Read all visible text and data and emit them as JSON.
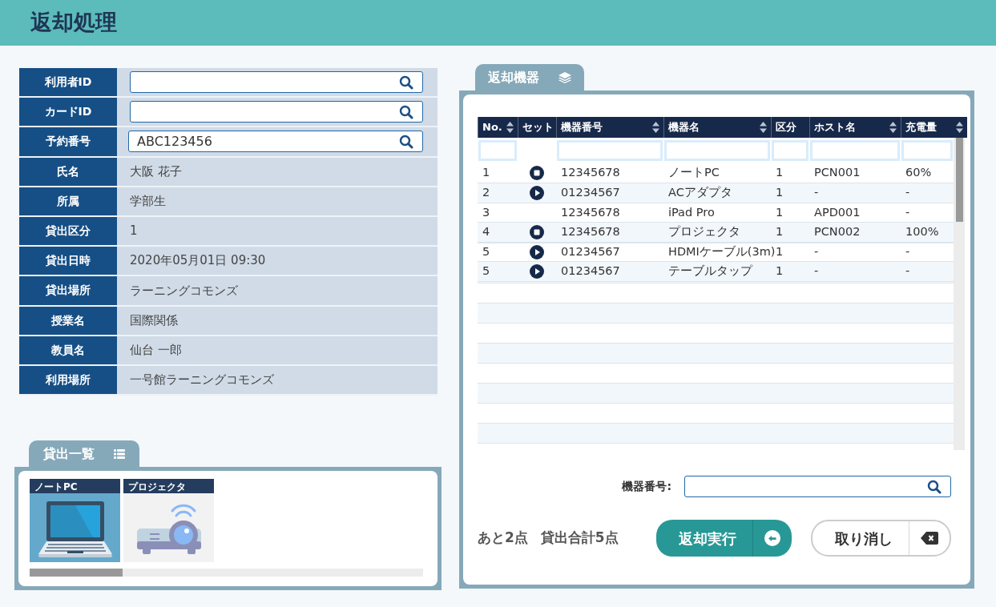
{
  "header": {
    "title": "返却処理"
  },
  "user_form": {
    "fields": [
      {
        "label": "利用者ID",
        "kind": "search"
      },
      {
        "label": "カードID",
        "kind": "search"
      },
      {
        "label": "予約番号",
        "kind": "search",
        "value": "ABC123456"
      },
      {
        "label": "氏名",
        "kind": "text",
        "value": "大阪 花子"
      },
      {
        "label": "所属",
        "kind": "text",
        "value": "学部生"
      },
      {
        "label": "貸出区分",
        "kind": "text",
        "value": "1"
      },
      {
        "label": "貸出日時",
        "kind": "text",
        "value": "2020年05月01日 09:30"
      },
      {
        "label": "貸出場所",
        "kind": "text",
        "value": "ラーニングコモンズ"
      },
      {
        "label": "授業名",
        "kind": "text",
        "value": "国際関係"
      },
      {
        "label": "教員名",
        "kind": "text",
        "value": "仙台 一郎"
      },
      {
        "label": "利用場所",
        "kind": "text",
        "value": "一号館ラーニングコモンズ"
      }
    ]
  },
  "loan_list": {
    "title": "貸出一覧",
    "items": [
      {
        "label": "ノートPC",
        "kind": "laptop",
        "selected": true
      },
      {
        "label": "プロジェクタ",
        "kind": "projector",
        "selected": false
      }
    ]
  },
  "return_devices": {
    "title": "返却機器",
    "columns": [
      {
        "label": "No.",
        "sortable": true,
        "filterable": true
      },
      {
        "label": "セット",
        "sortable": false,
        "filterable": false
      },
      {
        "label": "機器番号",
        "sortable": true,
        "filterable": true
      },
      {
        "label": "機器名",
        "sortable": true,
        "filterable": true
      },
      {
        "label": "区分",
        "sortable": false,
        "filterable": true
      },
      {
        "label": "ホスト名",
        "sortable": true,
        "filterable": true
      },
      {
        "label": "充電量",
        "sortable": true,
        "filterable": true
      }
    ],
    "rows": [
      {
        "no": "1",
        "kind": "stop",
        "device_no": "12345678",
        "device_name": "ノートPC",
        "category": "1",
        "host": "PCN001",
        "charge": "60%"
      },
      {
        "no": "2",
        "kind": "play",
        "device_no": "01234567",
        "device_name": "ACアダプタ",
        "category": "1",
        "host": "-",
        "charge": "-"
      },
      {
        "no": "3",
        "kind": "plain",
        "device_no": "12345678",
        "device_name": "iPad Pro",
        "category": "1",
        "host": "APD001",
        "charge": "-"
      },
      {
        "no": "4",
        "kind": "stop",
        "device_no": "12345678",
        "device_name": "プロジェクタ",
        "category": "1",
        "host": "PCN002",
        "charge": "100%"
      },
      {
        "no": "5",
        "kind": "play",
        "device_no": "01234567",
        "device_name": "HDMIケーブル(3m)",
        "category": "1",
        "host": "-",
        "charge": "-"
      },
      {
        "no": "5",
        "kind": "play",
        "device_no": "01234567",
        "device_name": "テーブルタップ",
        "category": "1",
        "host": "-",
        "charge": "-"
      }
    ],
    "device_number_field": {
      "label": "機器番号:"
    },
    "summary": [
      "あと2点",
      "貸出合計5点"
    ],
    "buttons": [
      {
        "label": "返却実行",
        "kind": "execute"
      },
      {
        "label": "取り消し",
        "kind": "cancel"
      }
    ]
  }
}
